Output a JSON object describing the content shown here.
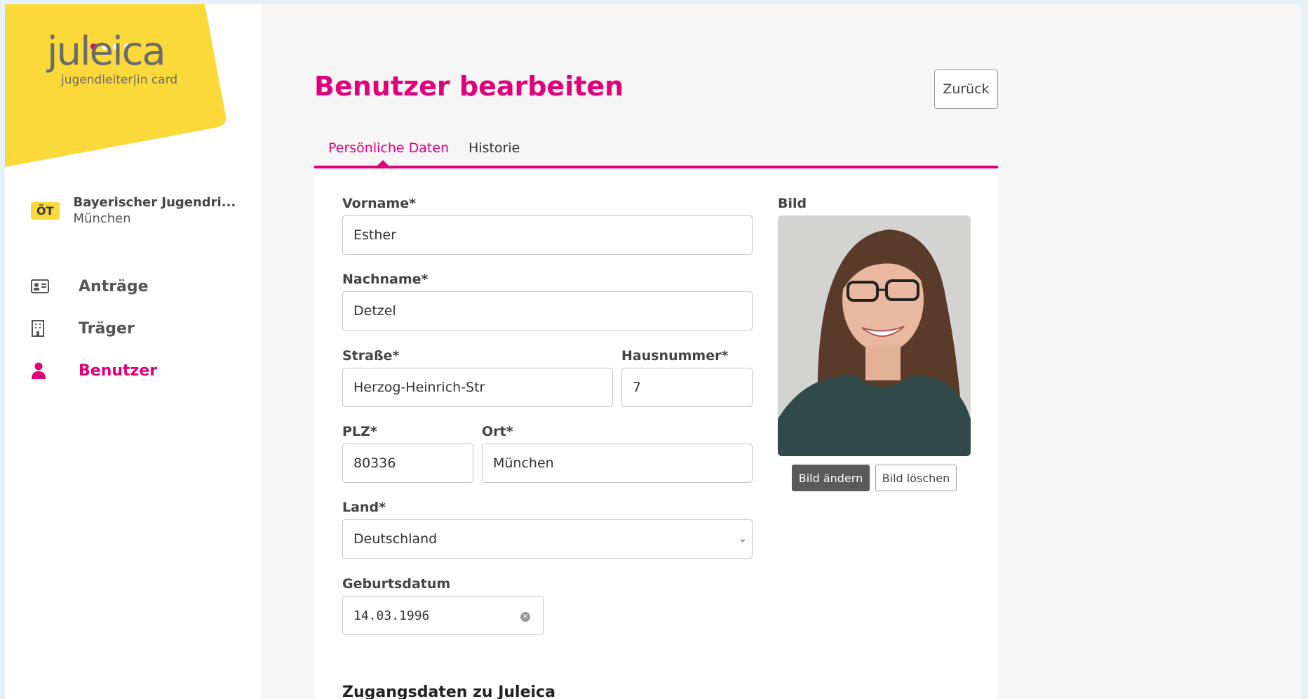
{
  "logo": {
    "word": "juleica",
    "tagline": "jugendleiter|in card"
  },
  "org": {
    "badge": "ÖT",
    "name": "Bayerischer Jugendri...",
    "city": "München"
  },
  "nav": [
    {
      "label": "Anträge",
      "icon": "id-card-icon"
    },
    {
      "label": "Träger",
      "icon": "building-icon"
    },
    {
      "label": "Benutzer",
      "icon": "user-icon",
      "active": true
    }
  ],
  "page": {
    "title": "Benutzer bearbeiten",
    "back_label": "Zurück"
  },
  "tabs": [
    {
      "label": "Persönliche Daten",
      "active": true
    },
    {
      "label": "Historie"
    }
  ],
  "form": {
    "vorname_label": "Vorname*",
    "vorname_value": "Esther",
    "nachname_label": "Nachname*",
    "nachname_value": "Detzel",
    "strasse_label": "Straße*",
    "strasse_value": "Herzog-Heinrich-Str",
    "hausnummer_label": "Hausnummer*",
    "hausnummer_value": "7",
    "plz_label": "PLZ*",
    "plz_value": "80336",
    "ort_label": "Ort*",
    "ort_value": "München",
    "land_label": "Land*",
    "land_value": "Deutschland",
    "geburtsdatum_label": "Geburtsdatum",
    "geburtsdatum_value": "14.03.1996"
  },
  "photo": {
    "label": "Bild",
    "change_label": "Bild ändern",
    "delete_label": "Bild löschen"
  },
  "section": {
    "zugang_title": "Zugangsdaten zu Juleica"
  },
  "colors": {
    "accent": "#e0007a",
    "logo_yellow": "#fcd93a"
  }
}
